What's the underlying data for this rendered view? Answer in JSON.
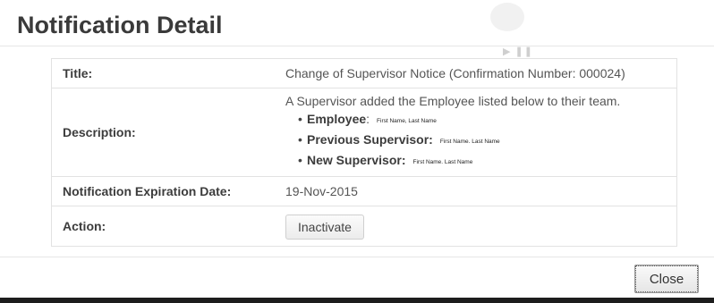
{
  "dialog": {
    "title": "Notification Detail",
    "close_label": "Close"
  },
  "fields": {
    "title_label": "Title:",
    "title_value": "Change of Supervisor Notice (Confirmation Number: 000024)",
    "description_label": "Description:",
    "description_text": "A Supervisor added the Employee listed below to their team.",
    "description_items": [
      {
        "field": "Employee",
        "separator": ":",
        "value": "First Name, Last Name"
      },
      {
        "field": "Previous Supervisor",
        "separator": ":",
        "value": "First Name. Last Name"
      },
      {
        "field": "New Supervisor",
        "separator": ":",
        "value": "First Name. Last Name"
      }
    ],
    "expiration_label": "Notification Expiration Date:",
    "expiration_value": "19-Nov-2015",
    "action_label": "Action:",
    "inactivate_label": "Inactivate"
  },
  "colors": {
    "title_text": "#3a3a3a",
    "border": "#e2e2e2",
    "bottom_bar": "#1d1d1d"
  }
}
